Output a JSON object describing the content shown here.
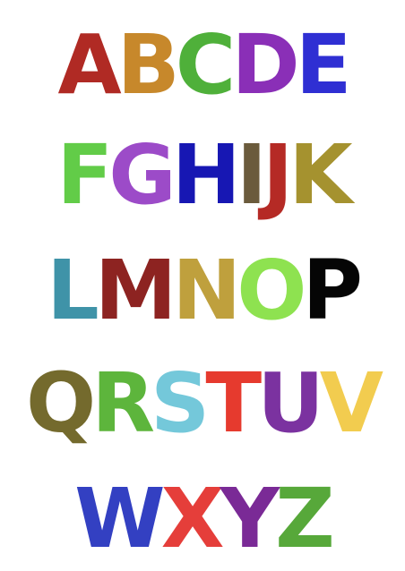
{
  "rows": [
    {
      "letters": [
        {
          "char": "A",
          "color": "#b02a24"
        },
        {
          "char": "B",
          "color": "#c7882b"
        },
        {
          "char": "C",
          "color": "#4fb03a"
        },
        {
          "char": "D",
          "color": "#8a2fb7"
        },
        {
          "char": "E",
          "color": "#2f2fd3"
        }
      ]
    },
    {
      "letters": [
        {
          "char": "F",
          "color": "#62cc48"
        },
        {
          "char": "G",
          "color": "#9c4bc8"
        },
        {
          "char": "H",
          "color": "#1717b3"
        },
        {
          "char": "I",
          "color": "#6b5b3c"
        },
        {
          "char": "J",
          "color": "#b52a25"
        },
        {
          "char": "K",
          "color": "#a5922f"
        }
      ]
    },
    {
      "letters": [
        {
          "char": "L",
          "color": "#3f93a8"
        },
        {
          "char": "M",
          "color": "#8d2321"
        },
        {
          "char": "N",
          "color": "#bfa03d"
        },
        {
          "char": "O",
          "color": "#8ee250"
        },
        {
          "char": "P",
          "color": "#050505"
        }
      ]
    },
    {
      "letters": [
        {
          "char": "Q",
          "color": "#746a2d"
        },
        {
          "char": "R",
          "color": "#5db53c"
        },
        {
          "char": "S",
          "color": "#74c8da"
        },
        {
          "char": "T",
          "color": "#e63a2e"
        },
        {
          "char": "U",
          "color": "#7b32a0"
        },
        {
          "char": "V",
          "color": "#f2cc4f"
        }
      ]
    },
    {
      "letters": [
        {
          "char": "W",
          "color": "#3340c2"
        },
        {
          "char": "X",
          "color": "#e53e3a"
        },
        {
          "char": "Y",
          "color": "#7a2a96"
        },
        {
          "char": "Z",
          "color": "#57a83a"
        }
      ]
    }
  ]
}
